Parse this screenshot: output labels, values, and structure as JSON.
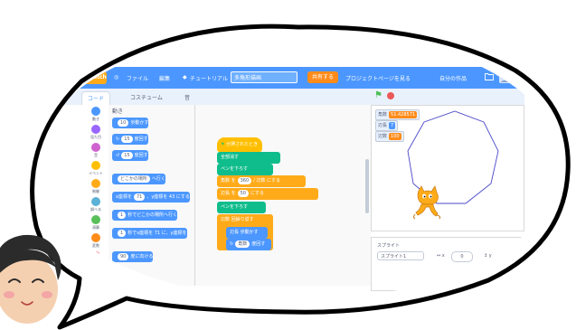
{
  "menubar": {
    "logo": "Scratch",
    "globe": "◎",
    "file": "ファイル",
    "edit": "編集",
    "tutorial_icon": "◆",
    "tutorial": "チュートリアル",
    "project_title": "多角形描画",
    "share": "共有する",
    "project_page": "プロジェクトページを見る",
    "my_stuff": "自分の作品",
    "folder_icon": "folder-icon",
    "avatar_icon": "avatar-icon"
  },
  "tabs": {
    "code": "コード",
    "costumes": "コスチューム",
    "sounds": "音"
  },
  "categories": [
    {
      "label": "動き",
      "color": "#4c97ff"
    },
    {
      "label": "見た目",
      "color": "#9966ff"
    },
    {
      "label": "音",
      "color": "#cf63cf"
    },
    {
      "label": "イベント",
      "color": "#ffbf00"
    },
    {
      "label": "制御",
      "color": "#ffab19"
    },
    {
      "label": "調べる",
      "color": "#5cb1d6"
    },
    {
      "label": "演算",
      "color": "#59c059"
    },
    {
      "label": "変数",
      "color": "#ff8c1a"
    },
    {
      "label": "ブロック定義",
      "color": "#ff6680"
    }
  ],
  "palette": {
    "heading": "動き",
    "blocks": [
      {
        "text_a": "",
        "oval": "10",
        "text_b": "歩動かす"
      },
      {
        "text_a": "↻",
        "oval": "15",
        "text_b": "度回す"
      },
      {
        "text_a": "↺",
        "oval": "15",
        "text_b": "度回す"
      },
      {
        "text_a": "",
        "oval": "どこかの場所",
        "text_b": "へ行く"
      },
      {
        "text_a": "x座標を",
        "oval": "71",
        "text_b": "、y座標を 43 にする"
      },
      {
        "text_a": "",
        "oval": "1",
        "text_b": "秒でどこかの場所へ行く"
      },
      {
        "text_a": "",
        "oval": "1",
        "text_b": "秒でx座標を 71 に、y座標を"
      },
      {
        "text_a": "",
        "oval": "90",
        "text_b": "度に向ける"
      }
    ]
  },
  "script": {
    "hat": "が押されたとき",
    "b1": "全部消す",
    "b2_a": "ペンを下ろす",
    "b3_a": "角数 を",
    "b3_oval": "360",
    "b3_b": "/ 辺数 にする",
    "b4_a": "辺長 を",
    "b4_oval": "50",
    "b4_b": "にする",
    "b5": "ペンを下ろす",
    "b6_a": "辺数",
    "b6_b": "回繰り返す",
    "b7_a": "辺長",
    "b7_b": "歩動かす",
    "b8_a": "↻",
    "b8_oval": "角数",
    "b8_b": "度回す"
  },
  "stage": {
    "monitors": [
      {
        "label": "角数",
        "value": "51.428571"
      },
      {
        "label": "辺長",
        "value": "7"
      },
      {
        "label": "辺数",
        "value": "100"
      }
    ],
    "shape": "heptagon",
    "sprite": "cat"
  },
  "sprite_pane": {
    "label": "スプライト",
    "name": "スプライト1",
    "x_label": "↔ x",
    "y_label": "↕ y",
    "x_value": "0",
    "y_value": "0"
  },
  "colors": {
    "menubar": "#4c97ff",
    "accent_orange": "#ff8c1a",
    "bubble_outline": "#000000"
  }
}
